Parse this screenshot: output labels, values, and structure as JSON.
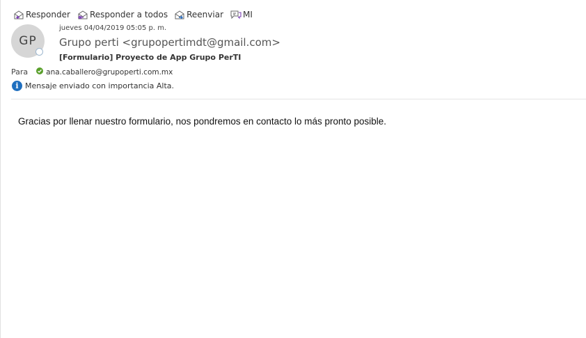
{
  "toolbar": {
    "reply_label": "Responder",
    "reply_all_label": "Responder a todos",
    "forward_label": "Reenviar",
    "im_label": "MI"
  },
  "message": {
    "avatar_initials": "GP",
    "date": "jueves 04/04/2019 05:05 p. m.",
    "sender": "Grupo perti <grupopertimdt@gmail.com>",
    "subject": "[Formulario] Proyecto de App Grupo PerTI",
    "to_label": "Para",
    "to_address": "ana.caballero@grupoperti.com.mx",
    "importance_text": "Mensaje enviado con importancia Alta.",
    "body": "Gracias por llenar nuestro formulario, nos pondremos en contacto lo más pronto posible."
  },
  "colors": {
    "info_icon": "#1f6fbf",
    "check_icon": "#5aa02c",
    "reply_arrow": "#7b3fb5",
    "forward_arrow": "#2d6fc0",
    "avatar_bg": "#d6d6d6"
  },
  "icons": {
    "reply": "reply-icon",
    "reply_all": "reply-all-icon",
    "forward": "forward-icon",
    "im": "chat-icon",
    "presence": "presence-status-icon",
    "check": "check-icon",
    "info": "info-icon"
  }
}
